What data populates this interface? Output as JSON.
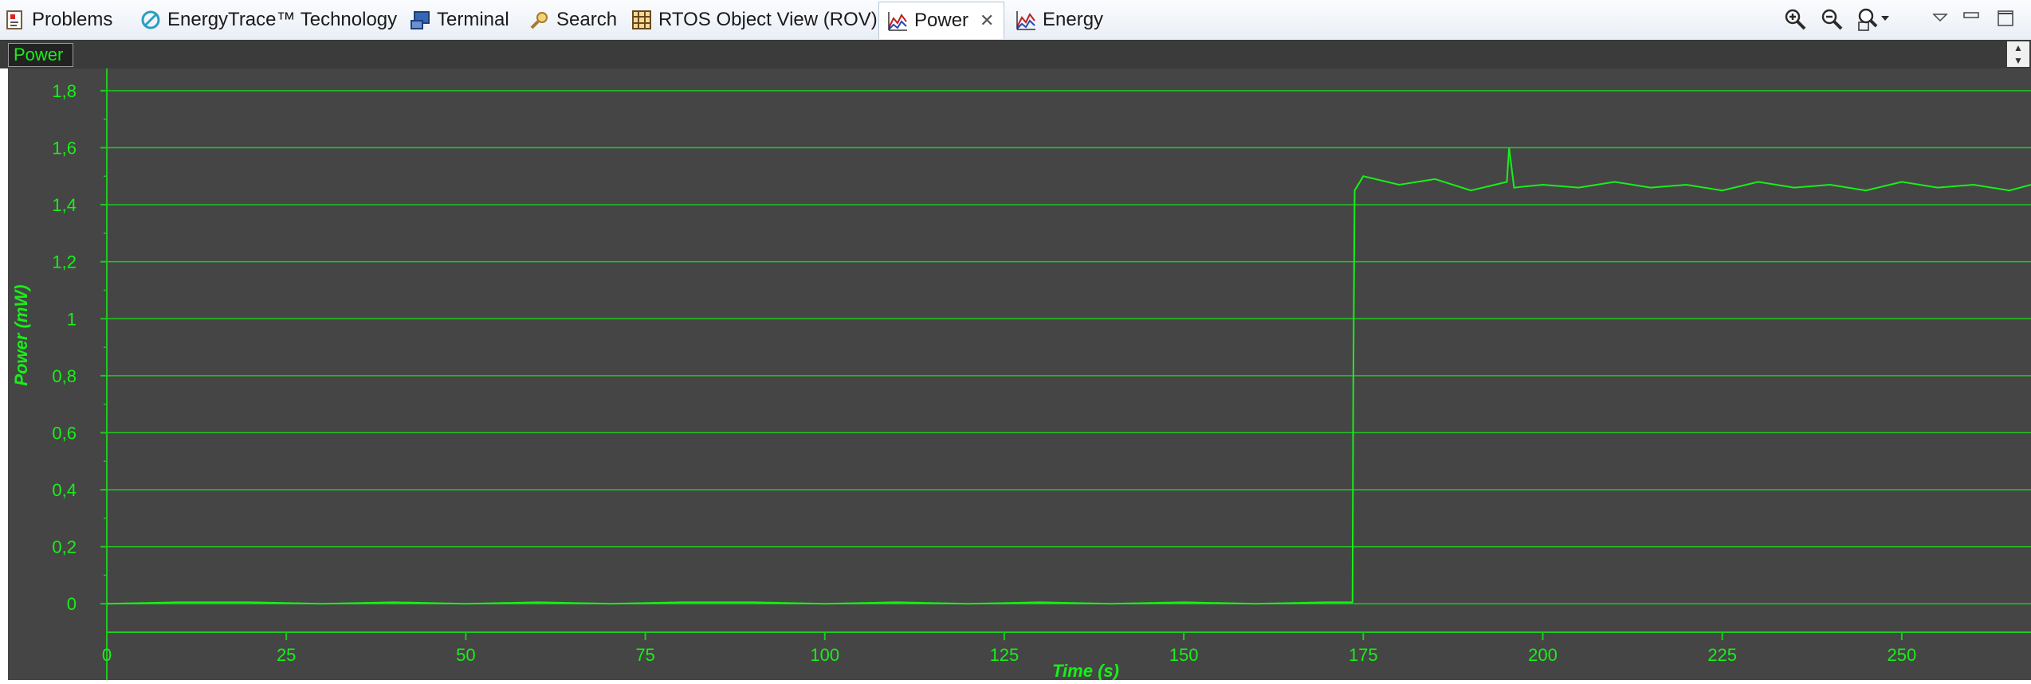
{
  "tabs": [
    {
      "label": "Problems",
      "icon": "problems-icon"
    },
    {
      "label": "EnergyTrace™ Technology",
      "icon": "energytrace-icon"
    },
    {
      "label": "Terminal",
      "icon": "terminal-icon"
    },
    {
      "label": "Search",
      "icon": "search-icon"
    },
    {
      "label": "RTOS Object View (ROV)",
      "icon": "grid-icon"
    },
    {
      "label": "Power",
      "icon": "chart-icon",
      "active": true
    },
    {
      "label": "Energy",
      "icon": "chart-icon"
    }
  ],
  "toolbar": [
    "zoom-in-icon",
    "zoom-out-icon",
    "zoom-fit-icon",
    "view-menu-icon",
    "minimize-icon",
    "maximize-icon"
  ],
  "strip_tab": "Power",
  "colors": {
    "plot_bg": "#454545",
    "trace": "#18ef18",
    "grid": "#1fc81f"
  },
  "chart_data": {
    "type": "line",
    "xlabel": "Time  (s)",
    "ylabel": "Power  (mW)",
    "xlim": [
      0,
      268
    ],
    "ylim": [
      -0.1,
      1.85
    ],
    "xticks": [
      0,
      25,
      50,
      75,
      100,
      125,
      150,
      175,
      200,
      225,
      250
    ],
    "xtick_labels": [
      "0",
      "25",
      "50",
      "75",
      "100",
      "125",
      "150",
      "175",
      "200",
      "225",
      "250"
    ],
    "yticks": [
      0,
      0.2,
      0.4,
      0.6,
      0.8,
      1,
      1.2,
      1.4,
      1.6,
      1.8
    ],
    "ytick_labels": [
      "0",
      "0,2",
      "0,4",
      "0,6",
      "0,8",
      "1",
      "1,2",
      "1,4",
      "1,6",
      "1,8"
    ],
    "grid": true,
    "series": [
      {
        "x": [
          0,
          10,
          20,
          30,
          40,
          50,
          60,
          70,
          80,
          90,
          100,
          110,
          120,
          130,
          140,
          150,
          160,
          170,
          173.5,
          173.6,
          173.8,
          175,
          180,
          185,
          190,
          195,
          195.3,
          196,
          200,
          205,
          210,
          215,
          220,
          225,
          230,
          235,
          240,
          245,
          250,
          255,
          260,
          265,
          268
        ],
        "y": [
          0,
          0.005,
          0.005,
          0,
          0.005,
          0,
          0.005,
          0,
          0.005,
          0.005,
          0,
          0.005,
          0,
          0.005,
          0,
          0.005,
          0,
          0.005,
          0.005,
          0.74,
          1.45,
          1.5,
          1.47,
          1.49,
          1.45,
          1.48,
          1.6,
          1.46,
          1.47,
          1.46,
          1.48,
          1.46,
          1.47,
          1.45,
          1.48,
          1.46,
          1.47,
          1.45,
          1.48,
          1.46,
          1.47,
          1.45,
          1.47
        ]
      }
    ]
  }
}
